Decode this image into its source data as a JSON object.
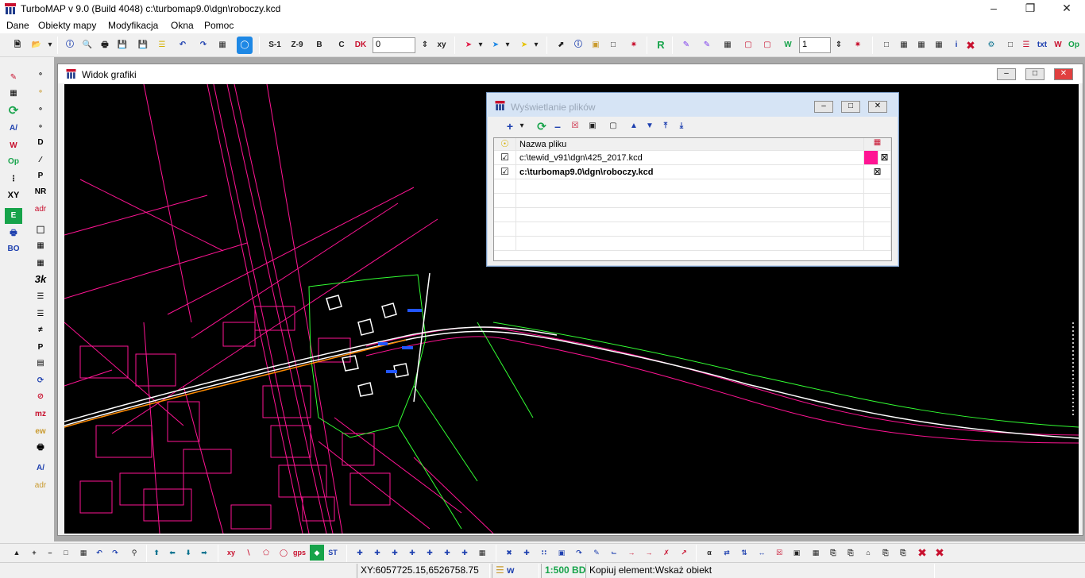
{
  "titlebar": {
    "title": "TurboMAP v 9.0 (Build 4048)   c:\\turbomap9.0\\dgn\\roboczy.kcd"
  },
  "menu": [
    "Dane",
    "Obiekty mapy",
    "Modyfikacja",
    "Okna",
    "Pomoc"
  ],
  "toolbar": {
    "scale_buttons": [
      "S-1",
      "Z-9",
      "B",
      "C"
    ],
    "dk_label": "DK",
    "coord_spin_value": "0",
    "xy_label": "xy",
    "r_label": "R",
    "level_spin_value": "1",
    "txt_label": "txt",
    "w_label": "W",
    "op_label": "Op"
  },
  "left_toolbar": {
    "label_op": "Op",
    "label_xy": "XY",
    "label_nr": "NR",
    "label_adr": "adr",
    "label_e": "E",
    "label_bo": "BO",
    "label_3k": "3k",
    "label_mz": "mz",
    "label_ew": "ew",
    "label_d": "D",
    "label_adr2": "adr"
  },
  "graphics_window": {
    "title": "Widok grafiki"
  },
  "file_dialog": {
    "title": "Wyświetlanie plików",
    "column_header": "Nazwa pliku",
    "files": [
      {
        "name": "c:\\tewid_v91\\dgn\\425_2017.kcd",
        "checked": true,
        "color": "#ff1493",
        "bold": false
      },
      {
        "name": "c:\\turbomap9.0\\dgn\\roboczy.kcd",
        "checked": true,
        "color": "#ffffff",
        "bold": true
      }
    ]
  },
  "bottom_toolbar": {
    "xy_label": "xy",
    "gps_label": "gps",
    "st_label": "ST"
  },
  "status": {
    "coords": "XY:6057725.15,6526758.75",
    "layer": "w",
    "scale": "1:500 BD",
    "message": "Kopiuj element:Wskaż obiekt"
  },
  "colors": {
    "map_bg": "#000000",
    "parcels": "#ff1493",
    "road": "#ffffff",
    "boundary": "#33ff33",
    "accent": "#ff8c00"
  }
}
